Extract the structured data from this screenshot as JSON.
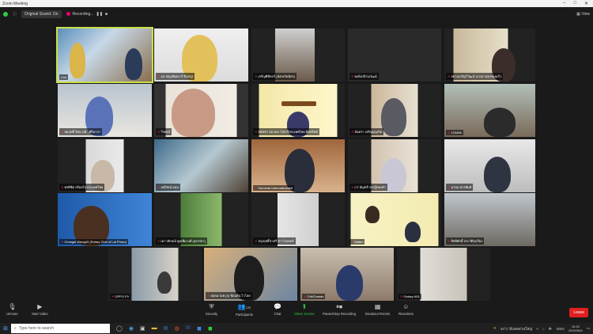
{
  "window": {
    "title": "Zoom Meeting"
  },
  "topbar": {
    "audio": "Original Sound: On",
    "recording": "Recording...",
    "view": "View"
  },
  "tiles": [
    {
      "name": "Live",
      "muted": false,
      "active": true
    },
    {
      "name": "A3 ปณุจพิเยอาร์ จีบสกุล",
      "muted": true
    },
    {
      "name": "เจริญพิชิตกร์ (ฉัตรเกิดมิตร)",
      "muted": true
    },
    {
      "name": "พงษ์เปป้าณวัฒน์",
      "muted": true
    },
    {
      "name": "สยามเจริญวิวัฒน์ นายมานพ ทองแก้ว",
      "muted": true
    },
    {
      "name": "สมฤทธิ์ รัตนวงศ์ - ศิริมาลา",
      "muted": true
    },
    {
      "name": "วีรพงษ์",
      "muted": true
    },
    {
      "name": "สมัชชา สมาคม โรตารีประเทศไทย ดิสทริคท์",
      "muted": true
    },
    {
      "name": "จันทรา เจริญบุญเกิด",
      "muted": true
    },
    {
      "name": "123456",
      "muted": true
    },
    {
      "name": "พรพิชิต สร้อยใจ ประเทศไทย",
      "muted": true
    },
    {
      "name": "มณีรัตน์ อ่อน",
      "muted": true
    },
    {
      "name": "Somchai Udomrattanakit",
      "muted": true
    },
    {
      "name": "CT อัญชลี รอบรู้ทองคำ",
      "muted": true
    },
    {
      "name": "นายน พวงพิมพ์",
      "muted": true
    },
    {
      "name": "Changai Wangd3 (Rotary Club of Lat Phrao)",
      "muted": true
    },
    {
      "name": "เยาวลักษณ์ พูลเพิ่มวงศ์ (สุจรรยา)",
      "muted": true
    },
    {
      "name": "ปรุงฤทธิ์ชาตรี ชาววังเทลล์",
      "muted": true
    },
    {
      "name": "Mateo",
      "muted": true
    },
    {
      "name": "สิทธิศักดิ์ ประวัติรุ่งเรือง",
      "muted": true
    },
    {
      "name": "OPPO F9",
      "muted": true
    },
    {
      "name": "ยอดมานพ (ล) ช้อนสิน ไวโลย",
      "muted": true
    },
    {
      "name": "ChitChanan",
      "muted": true
    },
    {
      "name": "Galaxy A51",
      "muted": true
    }
  ],
  "toolbar": {
    "unmute": "Unmute",
    "start_video": "Start Video",
    "security": "Security",
    "participants": "Participants",
    "participants_count": "120",
    "chat": "Chat",
    "share": "Share Screen",
    "recording": "Pause/Stop Recording",
    "breakout": "Breakout Rooms",
    "reactions": "Reactions",
    "leave": "Leave"
  },
  "taskbar": {
    "search_placeholder": "Type here to search",
    "weather": "34°C มีแดดส่วนใหญ่",
    "lang": "ENG",
    "time": "16:40",
    "date": "20/9/2564"
  },
  "colors": {
    "active_border": "#c8e04a",
    "leave": "#e02020",
    "share_green": "#2ecc40",
    "mic_muted": "#e33333"
  }
}
